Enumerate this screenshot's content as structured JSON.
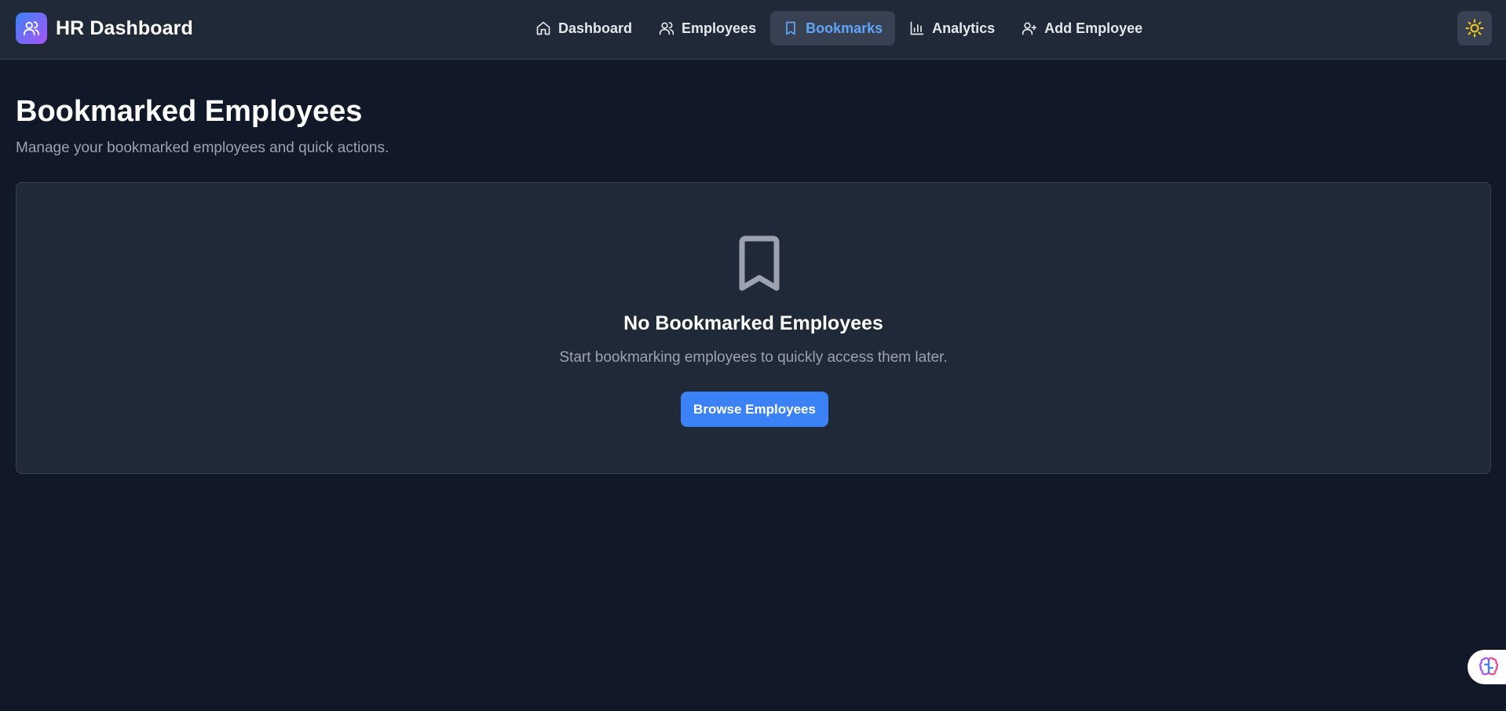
{
  "app": {
    "title": "HR Dashboard",
    "logo_icon": "users-icon"
  },
  "nav": {
    "items": [
      {
        "label": "Dashboard",
        "icon": "home-icon",
        "active": false
      },
      {
        "label": "Employees",
        "icon": "users-icon",
        "active": false
      },
      {
        "label": "Bookmarks",
        "icon": "bookmark-icon",
        "active": true
      },
      {
        "label": "Analytics",
        "icon": "bar-chart-icon",
        "active": false
      },
      {
        "label": "Add Employee",
        "icon": "user-plus-icon",
        "active": false
      }
    ]
  },
  "theme_toggle": {
    "icon": "sun-icon"
  },
  "page": {
    "title": "Bookmarked Employees",
    "subtitle": "Manage your bookmarked employees and quick actions."
  },
  "empty_state": {
    "icon": "bookmark-icon",
    "title": "No Bookmarked Employees",
    "text": "Start bookmarking employees to quickly access them later.",
    "button_label": "Browse Employees"
  },
  "floating_widget": {
    "icon": "brain-icon"
  },
  "colors": {
    "background": "#111827",
    "surface": "#1f2937",
    "border": "#374151",
    "accent": "#3b82f6",
    "active_text": "#60a5fa",
    "muted_text": "#9ca3af",
    "sun": "#facc15"
  }
}
